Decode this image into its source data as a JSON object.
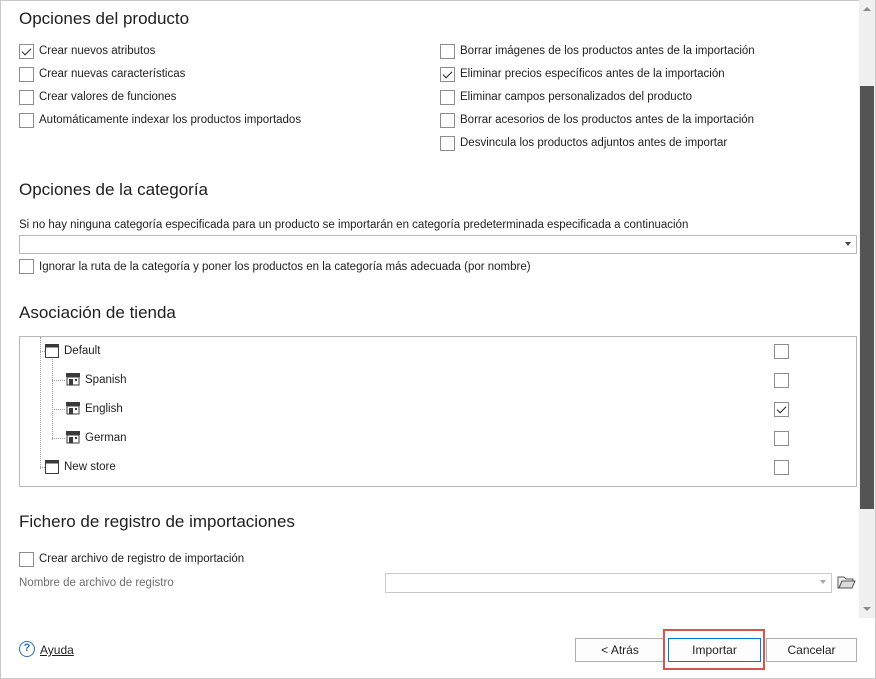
{
  "product_options": {
    "title": "Opciones del producto",
    "left": [
      {
        "label": "Crear nuevos atributos",
        "checked": true
      },
      {
        "label": "Crear nuevas características",
        "checked": false
      },
      {
        "label": "Crear valores de funciones",
        "checked": false
      },
      {
        "label": "Automáticamente indexar los productos importados",
        "checked": false
      }
    ],
    "right": [
      {
        "label": "Borrar imágenes de los productos antes de la importación",
        "checked": false
      },
      {
        "label": "Eliminar precios específicos antes de la importación",
        "checked": true
      },
      {
        "label": "Eliminar campos personalizados del producto",
        "checked": false
      },
      {
        "label": "Borrar acesorios de los productos antes de la importación",
        "checked": false
      },
      {
        "label": "Desvincula los productos adjuntos antes de importar",
        "checked": false
      }
    ]
  },
  "category_options": {
    "title": "Opciones de la categoría",
    "description": "Si no hay ninguna categoría especificada para un producto se importarán en categoría predeterminada especificada a continuación",
    "default_category_value": "",
    "ignore_path": {
      "label": "Ignorar la ruta de la categoría y poner los productos en la categoría más adecuada (por nombre)",
      "checked": false
    }
  },
  "store_association": {
    "title": "Asociación de tienda",
    "stores": [
      {
        "label": "Default",
        "level": 0,
        "checked": false
      },
      {
        "label": "Spanish",
        "level": 1,
        "checked": false
      },
      {
        "label": "English",
        "level": 1,
        "checked": true
      },
      {
        "label": "German",
        "level": 1,
        "checked": false
      },
      {
        "label": "New store",
        "level": 0,
        "checked": false
      }
    ]
  },
  "import_log": {
    "title": "Fichero de registro de importaciones",
    "create_log": {
      "label": "Crear archivo de registro de importación",
      "checked": false
    },
    "log_file_label": "Nombre de archivo de registro",
    "log_file_value": ""
  },
  "footer": {
    "help_label": "Ayuda",
    "back_label": "< Atrás",
    "import_label": "Importar",
    "cancel_label": "Cancelar"
  },
  "colors": {
    "highlight": "#d9534f",
    "help_blue": "#2a6ebb",
    "scroll_thumb": "#545454"
  }
}
